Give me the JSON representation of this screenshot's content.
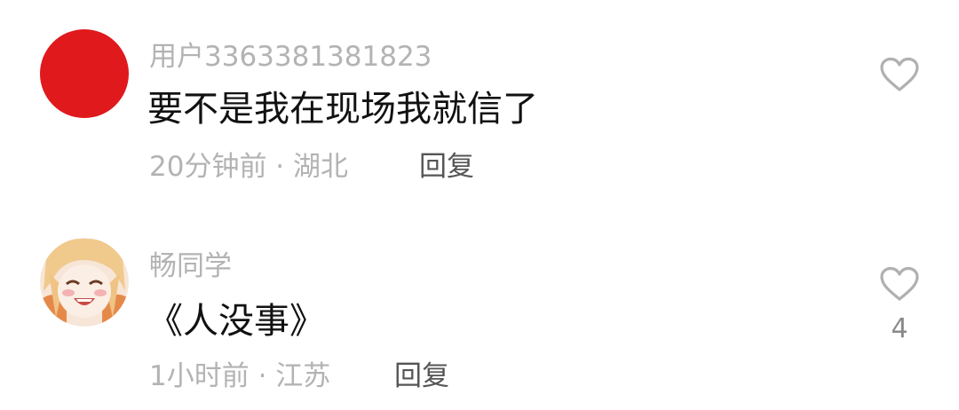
{
  "comments": [
    {
      "username": "用户3363381381823",
      "text": "要不是我在现场我就信了",
      "meta": "20分钟前 · 湖北",
      "reply_label": "回复",
      "avatar_color": "#e0191d",
      "like_icon": "heart-outline-icon",
      "like_count": ""
    },
    {
      "username": "畅同学",
      "text": "《人没事》",
      "meta": "1小时前 · 江苏",
      "reply_label": "回复",
      "avatar_icon": "anime-girl-avatar",
      "like_icon": "heart-outline-icon",
      "like_count": "4"
    }
  ]
}
